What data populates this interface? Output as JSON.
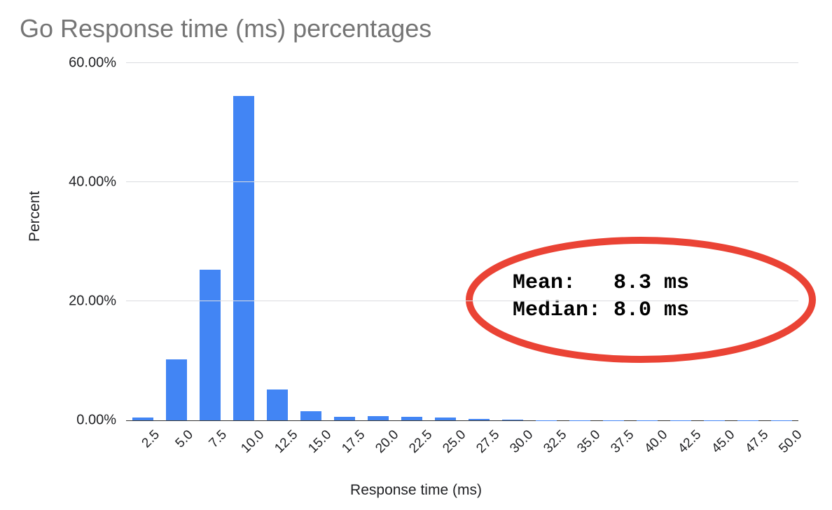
{
  "chart_data": {
    "type": "bar",
    "title": "Go Response time (ms) percentages",
    "xlabel": "Response time (ms)",
    "ylabel": "Percent",
    "ylim": [
      0,
      60
    ],
    "y_ticks": [
      "0.00%",
      "20.00%",
      "40.00%",
      "60.00%"
    ],
    "categories": [
      "2.5",
      "5.0",
      "7.5",
      "10.0",
      "12.5",
      "15.0",
      "17.5",
      "20.0",
      "22.5",
      "25.0",
      "27.5",
      "30.0",
      "32.5",
      "35.0",
      "37.5",
      "40.0",
      "42.5",
      "45.0",
      "47.5",
      "50.0"
    ],
    "values": [
      0.5,
      10.2,
      25.3,
      54.5,
      5.2,
      1.5,
      0.6,
      0.7,
      0.6,
      0.5,
      0.2,
      0.1,
      0.02,
      0.02,
      0.02,
      0.02,
      0.02,
      0.02,
      0.02,
      0.02
    ],
    "annotation": {
      "mean_label": "Mean:   8.3 ms",
      "median_label": "Median: 8.0 ms",
      "mean_ms": 8.3,
      "median_ms": 8.0,
      "ellipse_color": "#ea4335"
    }
  }
}
